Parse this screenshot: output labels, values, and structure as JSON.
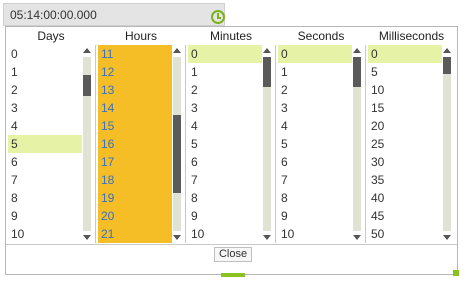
{
  "editor": {
    "value": "05:14:00:00.000",
    "clock_icon": "clock-icon",
    "accent_color": "#7ab21c"
  },
  "columns": [
    {
      "header": "Days",
      "items": [
        "0",
        "1",
        "2",
        "3",
        "4",
        "5",
        "6",
        "7",
        "8",
        "9",
        "10"
      ],
      "selected_index": 5,
      "scroll_thumb_position": 0.12,
      "scroll_thumb_size": 0.12
    },
    {
      "header": "Hours",
      "items": [
        "11",
        "12",
        "13",
        "14",
        "15",
        "16",
        "17",
        "18",
        "19",
        "20",
        "21"
      ],
      "selected_index": -1,
      "scroll_thumb_position": 0.6,
      "scroll_thumb_size": 0.45
    },
    {
      "header": "Minutes",
      "items": [
        "0",
        "1",
        "2",
        "3",
        "4",
        "5",
        "6",
        "7",
        "8",
        "9",
        "10"
      ],
      "selected_index": 0,
      "scroll_thumb_position": 0.0,
      "scroll_thumb_size": 0.17
    },
    {
      "header": "Seconds",
      "items": [
        "0",
        "1",
        "2",
        "3",
        "4",
        "5",
        "6",
        "7",
        "8",
        "9",
        "10"
      ],
      "selected_index": 0,
      "scroll_thumb_position": 0.0,
      "scroll_thumb_size": 0.17
    },
    {
      "header": "Milliseconds",
      "items": [
        "0",
        "5",
        "10",
        "15",
        "20",
        "25",
        "30",
        "35",
        "40",
        "45",
        "50"
      ],
      "selected_index": 0,
      "scroll_thumb_position": 0.0,
      "scroll_thumb_size": 0.1
    }
  ],
  "footer": {
    "close_label": "Close"
  },
  "colors": {
    "selection": "#e6f3a6",
    "hours_background": "#f5bd26",
    "hours_text": "#3a72c0",
    "scroll_track": "#e0e3d3",
    "scroll_thumb": "#5a5a5a"
  }
}
